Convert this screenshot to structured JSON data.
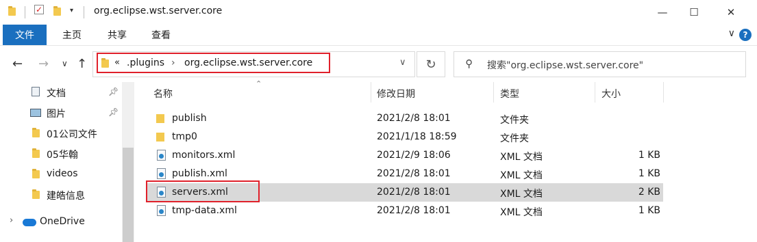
{
  "window": {
    "title": "org.eclipse.wst.server.core",
    "controls": {
      "minimize": "—",
      "maximize": "☐",
      "close": "✕"
    }
  },
  "ribbon": {
    "tabs": [
      "文件",
      "主页",
      "共享",
      "查看"
    ],
    "help": "?"
  },
  "nav": {
    "breadcrumb": {
      "overflow": "«",
      "parts": [
        ".plugins",
        "org.eclipse.wst.server.core"
      ]
    },
    "search_placeholder": "搜索\"org.eclipse.wst.server.core\""
  },
  "sidebar": {
    "items": [
      {
        "label": "文档",
        "icon": "document-icon",
        "pinned": true
      },
      {
        "label": "图片",
        "icon": "picture-icon",
        "pinned": true
      },
      {
        "label": "01公司文件",
        "icon": "folder-icon",
        "pinned": false
      },
      {
        "label": "05华翰",
        "icon": "folder-icon",
        "pinned": false
      },
      {
        "label": "videos",
        "icon": "folder-icon",
        "pinned": false
      },
      {
        "label": "建皓信息",
        "icon": "folder-icon",
        "pinned": false
      },
      {
        "label": "OneDrive",
        "icon": "onedrive-icon",
        "pinned": false
      }
    ]
  },
  "columns": {
    "name": "名称",
    "modified": "修改日期",
    "type": "类型",
    "size": "大小"
  },
  "files": [
    {
      "name": "publish",
      "modified": "2021/2/8 18:01",
      "type": "文件夹",
      "size": "",
      "kind": "folder"
    },
    {
      "name": "tmp0",
      "modified": "2021/1/18 18:59",
      "type": "文件夹",
      "size": "",
      "kind": "folder"
    },
    {
      "name": "monitors.xml",
      "modified": "2021/2/9 18:06",
      "type": "XML 文档",
      "size": "1 KB",
      "kind": "xml"
    },
    {
      "name": "publish.xml",
      "modified": "2021/2/8 18:01",
      "type": "XML 文档",
      "size": "1 KB",
      "kind": "xml"
    },
    {
      "name": "servers.xml",
      "modified": "2021/2/8 18:01",
      "type": "XML 文档",
      "size": "2 KB",
      "kind": "xml"
    },
    {
      "name": "tmp-data.xml",
      "modified": "2021/2/8 18:01",
      "type": "XML 文档",
      "size": "1 KB",
      "kind": "xml"
    }
  ],
  "selected_file": "servers.xml",
  "colors": {
    "accent": "#1a6fbf",
    "highlight": "#e0202a",
    "selection": "#d9d9d9"
  }
}
